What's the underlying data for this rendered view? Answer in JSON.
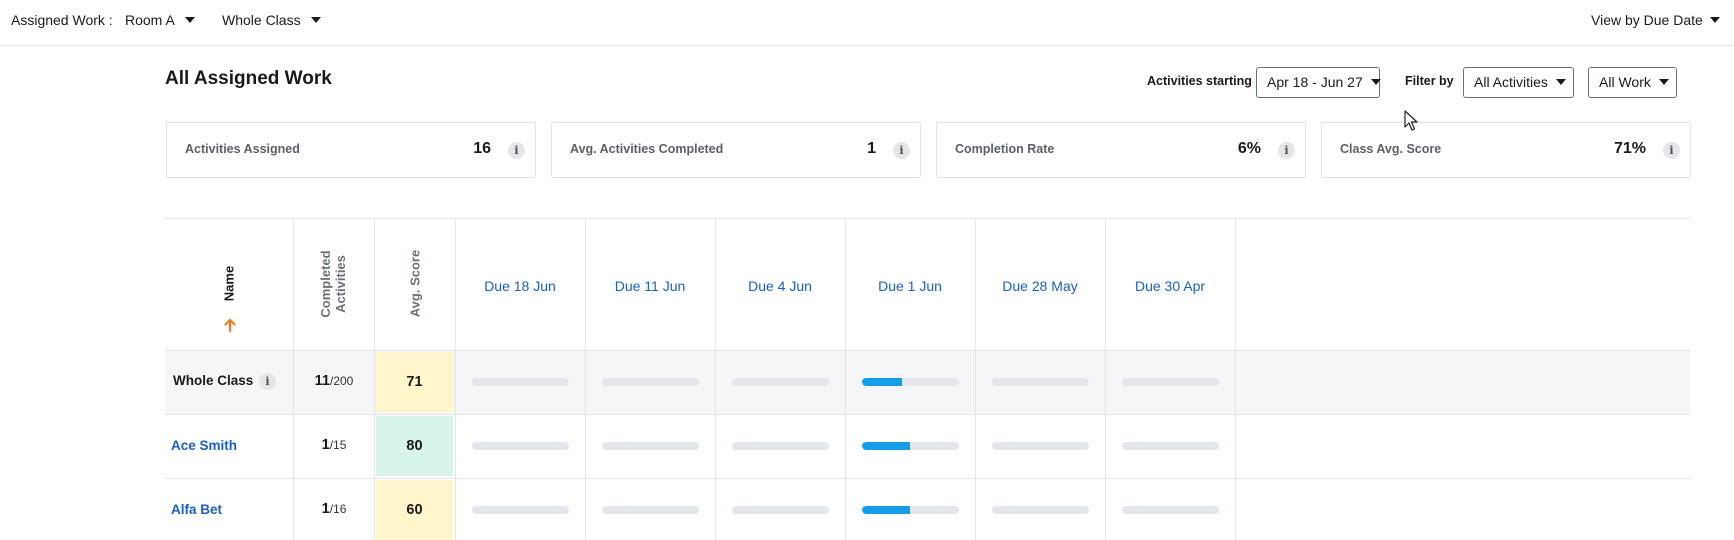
{
  "topbar": {
    "label": "Assigned Work :",
    "room": "Room A",
    "group": "Whole Class",
    "view": "View by Due Date"
  },
  "page": {
    "title": "All Assigned Work",
    "activities_starting_label": "Activities starting",
    "date_range": "Apr 18 - Jun 27",
    "filter_label": "Filter by",
    "activity_filter": "All Activities",
    "work_filter": "All Work"
  },
  "summary": [
    {
      "label": "Activities Assigned",
      "value": "16"
    },
    {
      "label": "Avg. Activities Completed",
      "value": "1"
    },
    {
      "label": "Completion Rate",
      "value": "6%"
    },
    {
      "label": "Class Avg. Score",
      "value": "71%"
    }
  ],
  "info_glyph": "i",
  "table": {
    "name_header": "Name",
    "completed_header_1": "Completed",
    "completed_header_2": "Activities",
    "score_header": "Avg. Score",
    "due_columns": [
      "Due 18 Jun",
      "Due 11 Jun",
      "Due 4 Jun",
      "Due 1 Jun",
      "Due 28 May",
      "Due 30 Apr"
    ],
    "rows": [
      {
        "name": "Whole Class",
        "completed": "11",
        "total": "/200",
        "score": "71",
        "score_color": "#fff6cc",
        "progress": [
          0,
          0,
          0,
          0.42,
          0,
          0
        ]
      },
      {
        "name": "Ace Smith",
        "completed": "1",
        "total": "/15",
        "score": "80",
        "score_color": "#d7f5ec",
        "progress": [
          0,
          0,
          0,
          0.5,
          0,
          0
        ]
      },
      {
        "name": "Alfa Bet",
        "completed": "1",
        "total": "/16",
        "score": "60",
        "score_color": "#fff6cc",
        "progress": [
          0,
          0,
          0,
          0.5,
          0,
          0
        ]
      }
    ]
  },
  "colors": {
    "link": "#1a5fbf",
    "sort_arrow": "#f07d1a",
    "progress_fill": "#139fe8",
    "progress_track": "#e3e6ea"
  }
}
